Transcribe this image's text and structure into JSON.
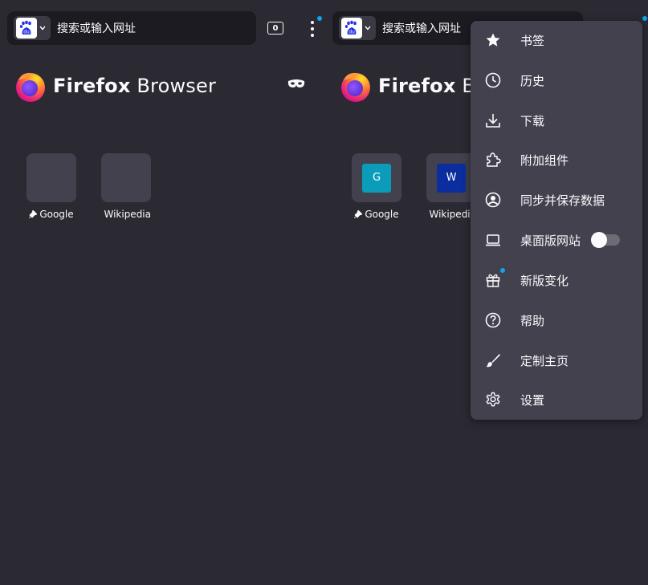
{
  "colors": {
    "background": "#2b2a33",
    "urlbar": "#1c1b22",
    "menu": "#42414d",
    "accent_dot": "#0ca6e9",
    "text": "#fbfbfe"
  },
  "left_pane": {
    "url_placeholder": "搜索或输入网址",
    "tab_count": "0",
    "brand": {
      "bold": "Firefox",
      "rest": " Browser"
    },
    "sites": [
      {
        "label": "Google"
      },
      {
        "label": "Wikipedia"
      }
    ]
  },
  "right_pane": {
    "url_placeholder": "搜索或输入网址",
    "brand": {
      "bold": "Firefox",
      "rest": " Browser"
    },
    "sites": [
      {
        "label": "Google",
        "favicon": "G",
        "color": "#0a9cb8"
      },
      {
        "label": "Wikipedia",
        "favicon": "W",
        "color": "#0b2d9e"
      }
    ]
  },
  "menu": {
    "items": [
      {
        "label": "书签",
        "icon": "star-icon"
      },
      {
        "label": "历史",
        "icon": "clock-icon"
      },
      {
        "label": "下载",
        "icon": "download-icon"
      },
      {
        "label": "附加组件",
        "icon": "puzzle-icon"
      },
      {
        "label": "同步并保存数据",
        "icon": "account-icon"
      },
      {
        "label": "桌面版网站",
        "icon": "laptop-icon",
        "toggle": "off"
      },
      {
        "label": "新版变化",
        "icon": "gift-icon"
      },
      {
        "label": "帮助",
        "icon": "help-icon"
      },
      {
        "label": "定制主页",
        "icon": "brush-icon"
      },
      {
        "label": "设置",
        "icon": "gear-icon"
      }
    ]
  }
}
